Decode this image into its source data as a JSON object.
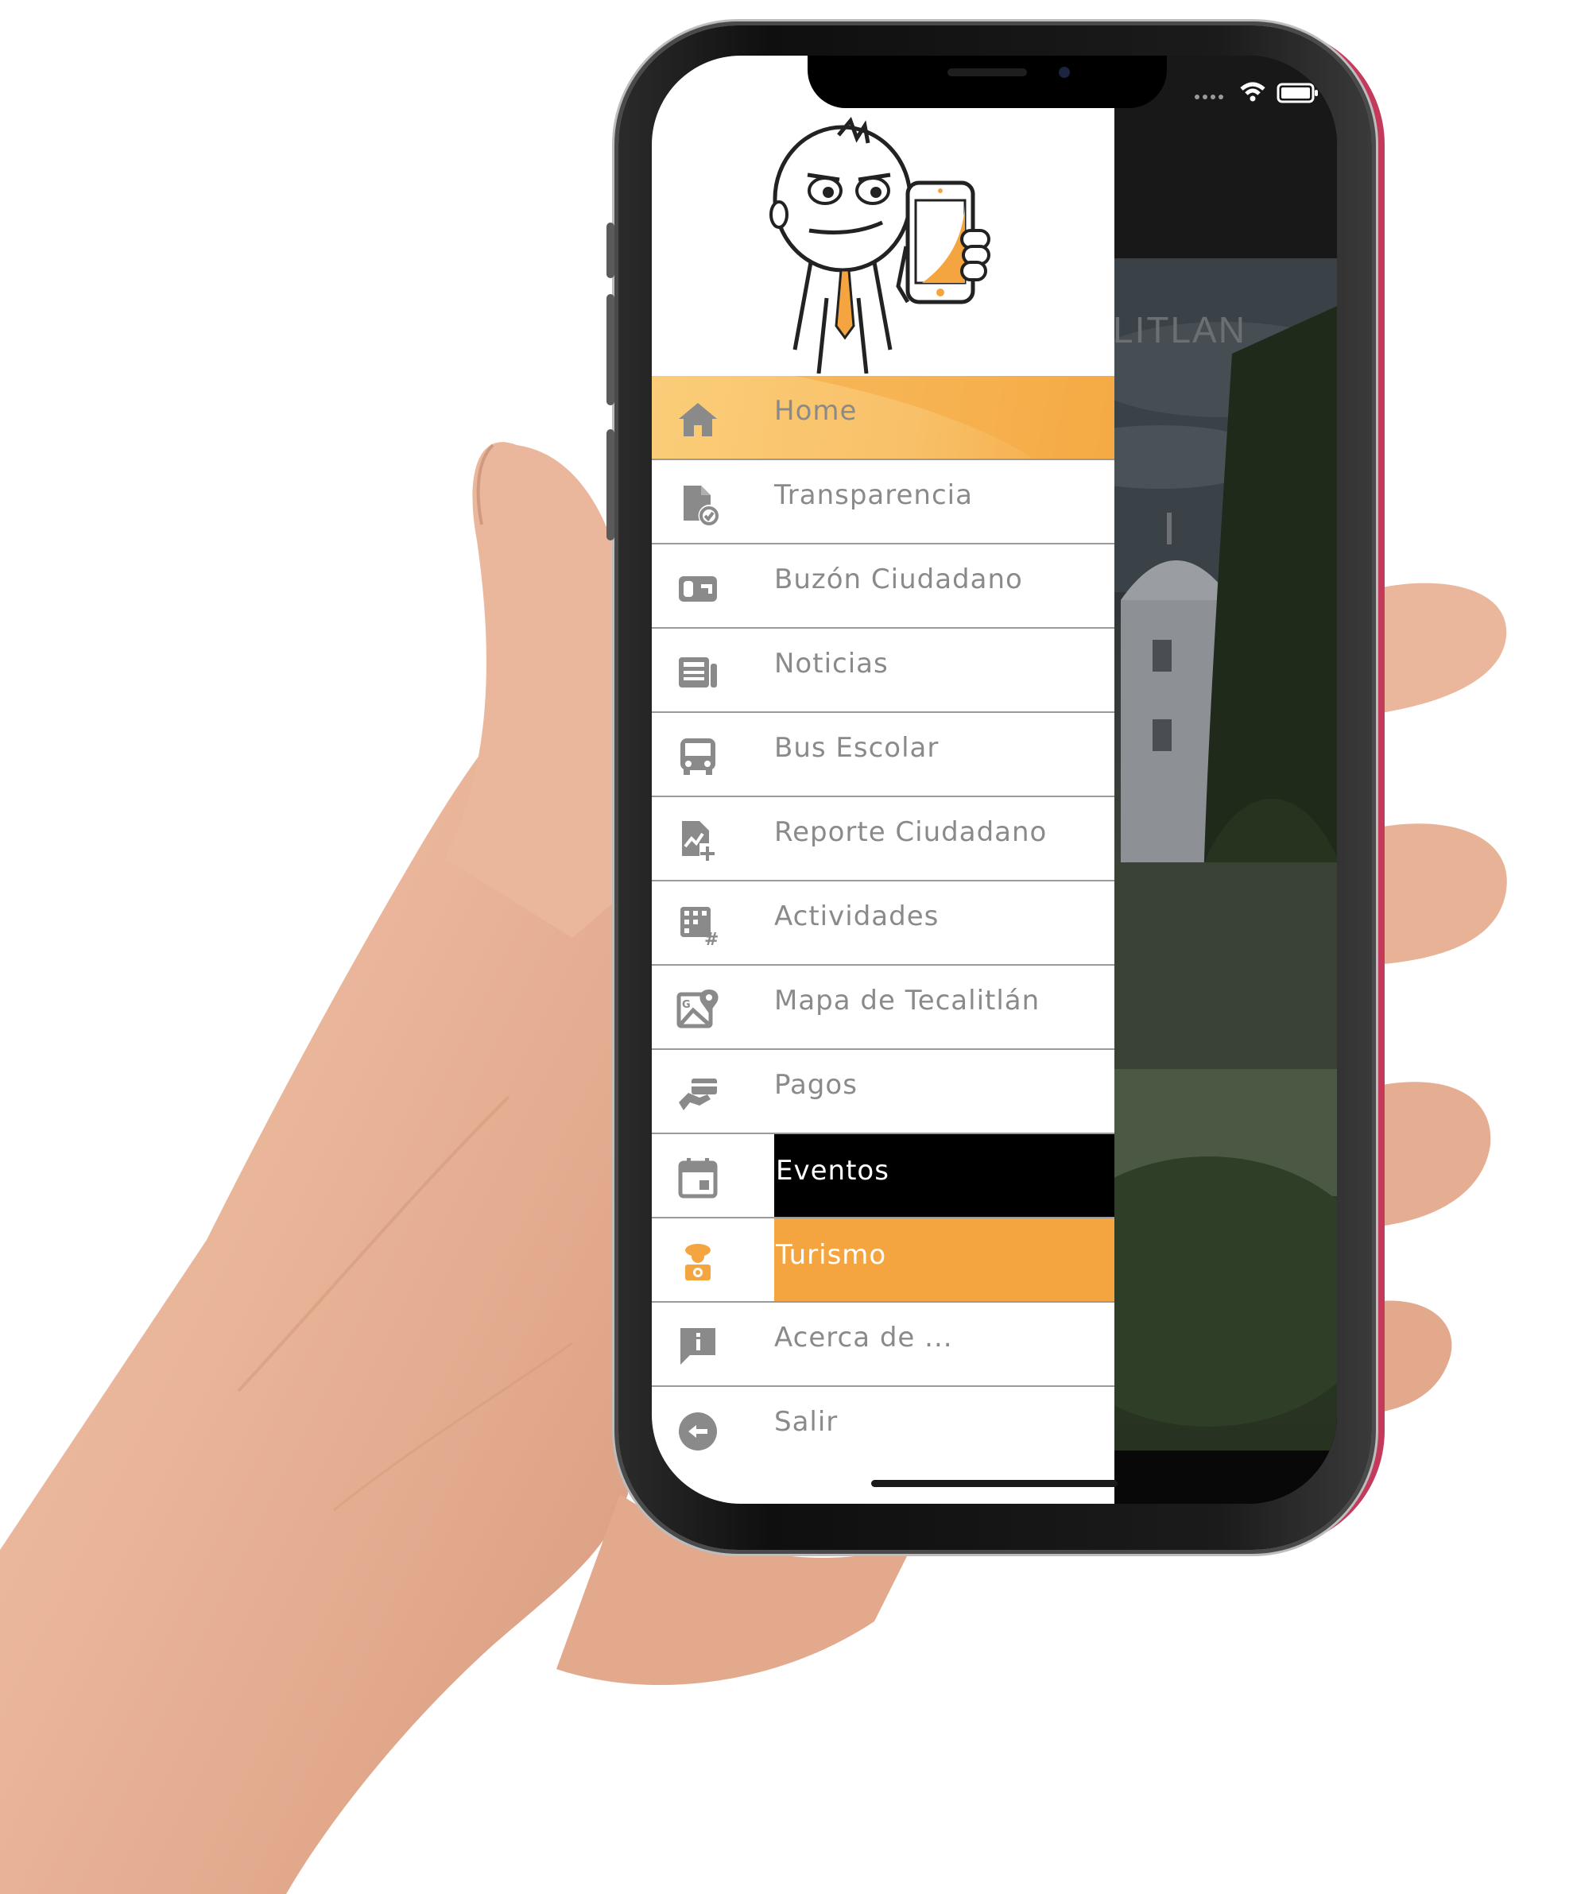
{
  "background_app": {
    "title": "LITLAN"
  },
  "drawer": {
    "menu": [
      {
        "label": "Home",
        "icon": "home-icon",
        "state": "highlighted"
      },
      {
        "label": "Transparencia",
        "icon": "document-check-icon"
      },
      {
        "label": "Buzón Ciudadano",
        "icon": "mailbox-icon"
      },
      {
        "label": "Noticias",
        "icon": "newspaper-icon"
      },
      {
        "label": "Bus Escolar",
        "icon": "bus-icon"
      },
      {
        "label": "Reporte Ciudadano",
        "icon": "report-add-icon"
      },
      {
        "label": "Actividades",
        "icon": "grid-calendar-icon"
      },
      {
        "label": "Mapa de Tecalitlán",
        "icon": "map-pin-icon"
      },
      {
        "label": "Pagos",
        "icon": "payment-icon"
      },
      {
        "label": "Eventos",
        "icon": "calendar-icon",
        "state": "pressed"
      },
      {
        "label": "Turismo",
        "icon": "tourist-icon",
        "state": "selected"
      },
      {
        "label": "Acerca de ...",
        "icon": "info-bubble-icon"
      },
      {
        "label": "Salir",
        "icon": "exit-icon"
      }
    ]
  },
  "colors": {
    "accent_orange": "#f5a540",
    "home_highlight": "#f8c169",
    "pressed_black": "#000000",
    "icon_gray": "#8a8a8a"
  }
}
